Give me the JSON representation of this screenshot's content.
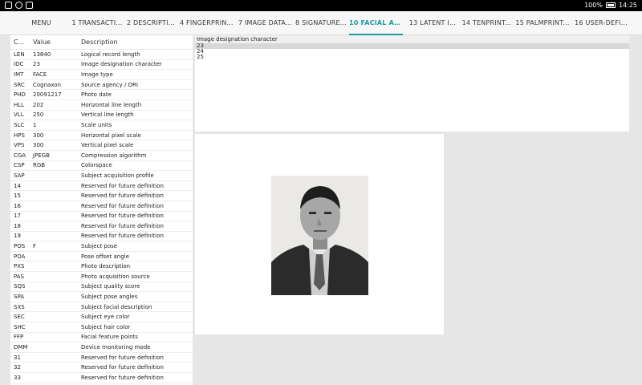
{
  "status_bar": {
    "battery": "100%",
    "time": "14:25"
  },
  "tabs": [
    {
      "label": "MENU",
      "active": false
    },
    {
      "label": "1 TRANSACTI...",
      "active": false
    },
    {
      "label": "2 DESCRIPTIV...",
      "active": false
    },
    {
      "label": "4 FINGERPRINT...",
      "active": false
    },
    {
      "label": "7 IMAGE DATA...",
      "active": false
    },
    {
      "label": "8 SIGNATURE...",
      "active": false
    },
    {
      "label": "10 FACIAL AN...",
      "active": true
    },
    {
      "label": "13 LATENT I...",
      "active": false
    },
    {
      "label": "14 TENPRINT...",
      "active": false
    },
    {
      "label": "15 PALMPRINT...",
      "active": false
    },
    {
      "label": "16 USER-DEFI...",
      "active": false
    }
  ],
  "table": {
    "headers": [
      "C...",
      "Value",
      "Description"
    ],
    "rows": [
      [
        "LEN",
        "13840",
        "Logical record length"
      ],
      [
        "IDC",
        "23",
        "Image designation character"
      ],
      [
        "IMT",
        "FACE",
        "Image type"
      ],
      [
        "SRC",
        "Cognaxon",
        "Source agency / ORI"
      ],
      [
        "PHD",
        "20091217",
        "Photo date"
      ],
      [
        "HLL",
        "202",
        "Horizontal line length"
      ],
      [
        "VLL",
        "250",
        "Vertical line length"
      ],
      [
        "SLC",
        "1",
        "Scale units"
      ],
      [
        "HPS",
        "300",
        "Horizontal pixel scale"
      ],
      [
        "VPS",
        "300",
        "Vertical pixel scale"
      ],
      [
        "CGA",
        "JPEGB",
        "Compression algorithm"
      ],
      [
        "CSP",
        "RGB",
        "Colorspace"
      ],
      [
        "SAP",
        "",
        "Subject acquisition profile"
      ],
      [
        "14",
        "",
        "Reserved for future definition"
      ],
      [
        "15",
        "",
        "Reserved for future definition"
      ],
      [
        "16",
        "",
        "Reserved for future definition"
      ],
      [
        "17",
        "",
        "Reserved for future definition"
      ],
      [
        "18",
        "",
        "Reserved for future definition"
      ],
      [
        "19",
        "",
        "Reserved for future definition"
      ],
      [
        "POS",
        "F",
        "Subject pose"
      ],
      [
        "POA",
        "",
        "Pose offset angle"
      ],
      [
        "PXS",
        "",
        "Photo description"
      ],
      [
        "PAS",
        "",
        "Photo acquisition source"
      ],
      [
        "SQS",
        "",
        "Subject quality score"
      ],
      [
        "SPA",
        "",
        "Subject pose angles"
      ],
      [
        "SXS",
        "",
        "Subject facial description"
      ],
      [
        "SEC",
        "",
        "Subject eye color"
      ],
      [
        "SHC",
        "",
        "Subject hair color"
      ],
      [
        "FFP",
        "",
        "Facial feature points"
      ],
      [
        "DMM",
        "",
        "Device monitoring mode"
      ],
      [
        "31",
        "",
        "Reserved for future definition"
      ],
      [
        "32",
        "",
        "Reserved for future definition"
      ],
      [
        "33",
        "",
        "Reserved for future definition"
      ]
    ]
  },
  "detail": {
    "title": "Image designation character",
    "options": [
      {
        "value": "23",
        "selected": true
      },
      {
        "value": "24",
        "selected": false
      },
      {
        "value": "25",
        "selected": false
      }
    ]
  },
  "image": {
    "icon": "facial-photo"
  }
}
